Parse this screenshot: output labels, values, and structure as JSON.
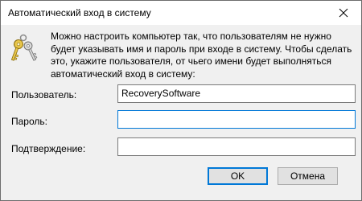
{
  "window": {
    "title": "Автоматический вход в систему",
    "close_glyph": "✕"
  },
  "description": "Можно настроить компьютер так, что пользователям не нужно будет указывать имя и пароль при входе в систему. Чтобы сделать это, укажите пользователя, от чьего имени будет выполняться автоматический вход в систему:",
  "fields": {
    "user_label": "Пользователь:",
    "user_value": "RecoverySoftware",
    "password_label": "Пароль:",
    "password_value": "",
    "confirm_label": "Подтверждение:",
    "confirm_value": ""
  },
  "buttons": {
    "ok_label": "OK",
    "cancel_label": "Отмена"
  },
  "icons": {
    "keys": "keys-icon",
    "close": "close-icon"
  }
}
